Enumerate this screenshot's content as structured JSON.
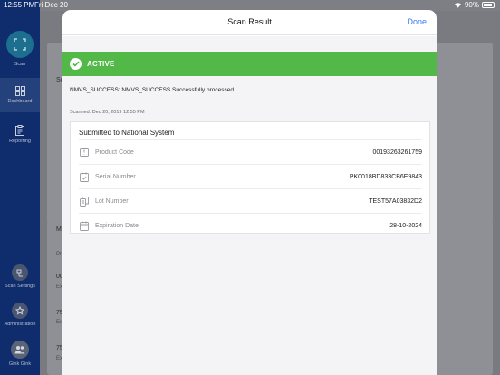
{
  "status_bar": {
    "time": "12:55 PM",
    "date": "Fri Dec 20",
    "battery": "90%"
  },
  "sidebar": {
    "items": [
      {
        "label": "Scan",
        "icon": "scan-icon"
      },
      {
        "label": "Dashboard",
        "icon": "grid-icon"
      },
      {
        "label": "Reporting",
        "icon": "clipboard-icon"
      },
      {
        "label": "Scan Settings",
        "icon": "scan-settings-icon"
      },
      {
        "label": "Administration",
        "icon": "star-badge-icon"
      },
      {
        "label": "Gink Gink",
        "icon": "user-group-icon"
      }
    ]
  },
  "background": {
    "top_card_title_fragment": "Sc",
    "list_title_fragment": "Mo",
    "list_header_fragment": "Pr",
    "rows": [
      {
        "title": "00",
        "sub": "Ex"
      },
      {
        "title": "75",
        "sub": "Ex"
      },
      {
        "title": "75",
        "sub": "Ex"
      }
    ]
  },
  "modal": {
    "title": "Scan Result",
    "done_label": "Done",
    "status": {
      "label": "ACTIVE",
      "color": "#52b848"
    },
    "message": "NMVS_SUCCESS: NMVS_SUCCESS Successfully processed.",
    "scanned": "Scanned: Dec 20, 2019 12:55 PM",
    "card": {
      "title": "Submitted to National System",
      "rows": [
        {
          "label": "Product Code",
          "value": "00193263261759",
          "icon": "product-code-icon"
        },
        {
          "label": "Serial Number",
          "value": "PK0018BD833CB6E9843",
          "icon": "serial-check-icon"
        },
        {
          "label": "Lot Number",
          "value": "TEST57A03832D2",
          "icon": "lot-copy-icon"
        },
        {
          "label": "Expiration Date",
          "value": "28-10-2024",
          "icon": "calendar-icon"
        }
      ]
    }
  }
}
